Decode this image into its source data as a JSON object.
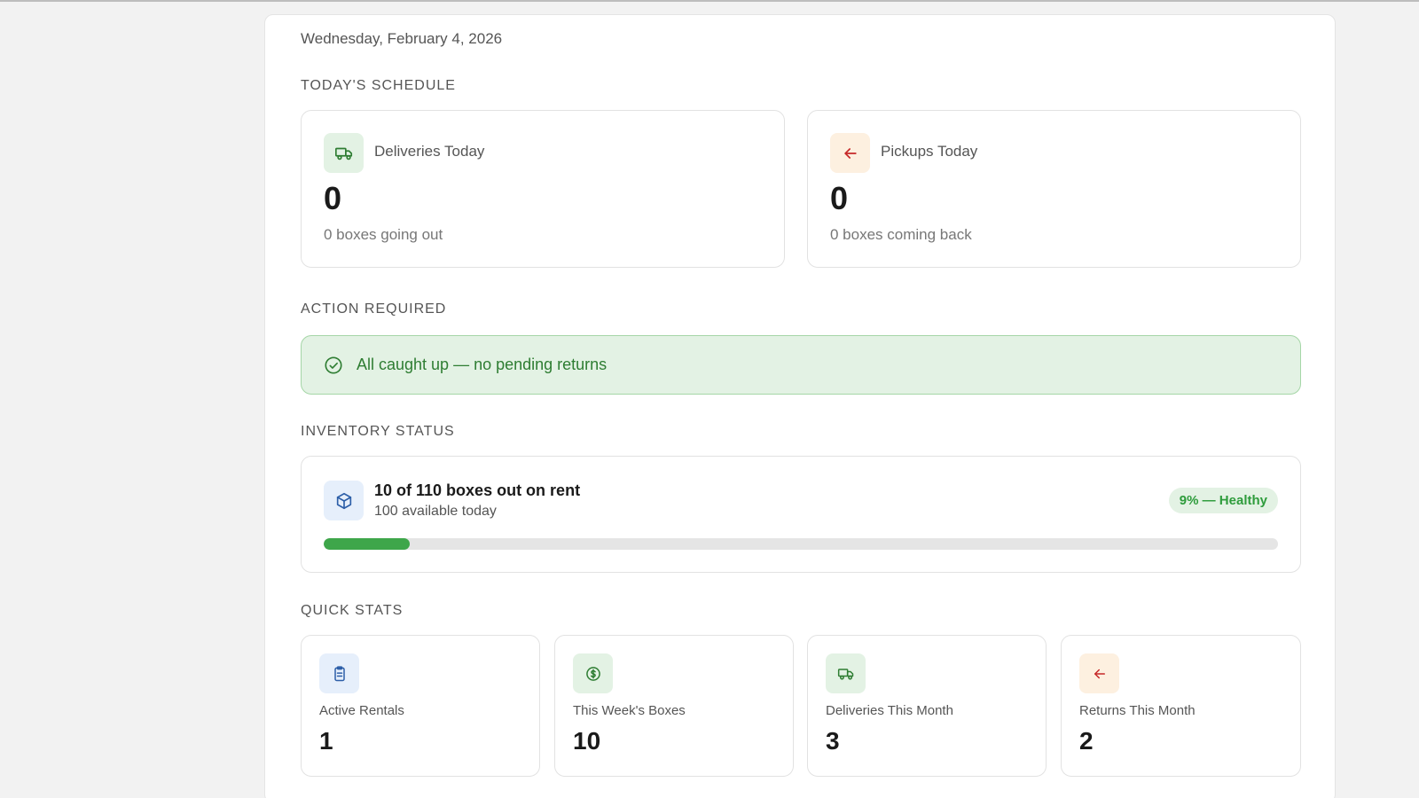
{
  "header": {
    "date": "Wednesday, February 4, 2026"
  },
  "schedule": {
    "title": "TODAY'S SCHEDULE",
    "deliveries": {
      "icon": "truck-icon",
      "label": "Deliveries Today",
      "value": "0",
      "sub": "0 boxes going out"
    },
    "pickups": {
      "icon": "arrow-left-icon",
      "label": "Pickups Today",
      "value": "0",
      "sub": "0 boxes coming back"
    }
  },
  "action": {
    "title": "ACTION REQUIRED",
    "icon": "check-circle-icon",
    "message": "All caught up — no pending returns"
  },
  "inventory": {
    "title": "INVENTORY STATUS",
    "icon": "box-icon",
    "headline": "10 of 110 boxes out on rent",
    "sub": "100 available today",
    "badge": "9% — Healthy",
    "progress_fraction": 0.09
  },
  "quick_stats": {
    "title": "QUICK STATS",
    "items": [
      {
        "icon": "clipboard-icon",
        "label": "Active Rentals",
        "value": "1"
      },
      {
        "icon": "dollar-circle-icon",
        "label": "This Week's Boxes",
        "value": "10"
      },
      {
        "icon": "truck-icon",
        "label": "Deliveries This Month",
        "value": "3"
      },
      {
        "icon": "arrow-left-icon",
        "label": "Returns This Month",
        "value": "2"
      }
    ]
  },
  "colors": {
    "green": "#2e7d32",
    "green_bg": "#e3f2e4",
    "orange_bg": "#fdf0e0",
    "red": "#c62828",
    "blue": "#2d5fa8",
    "blue_bg": "#e6effb",
    "progress": "#3ea64a"
  }
}
